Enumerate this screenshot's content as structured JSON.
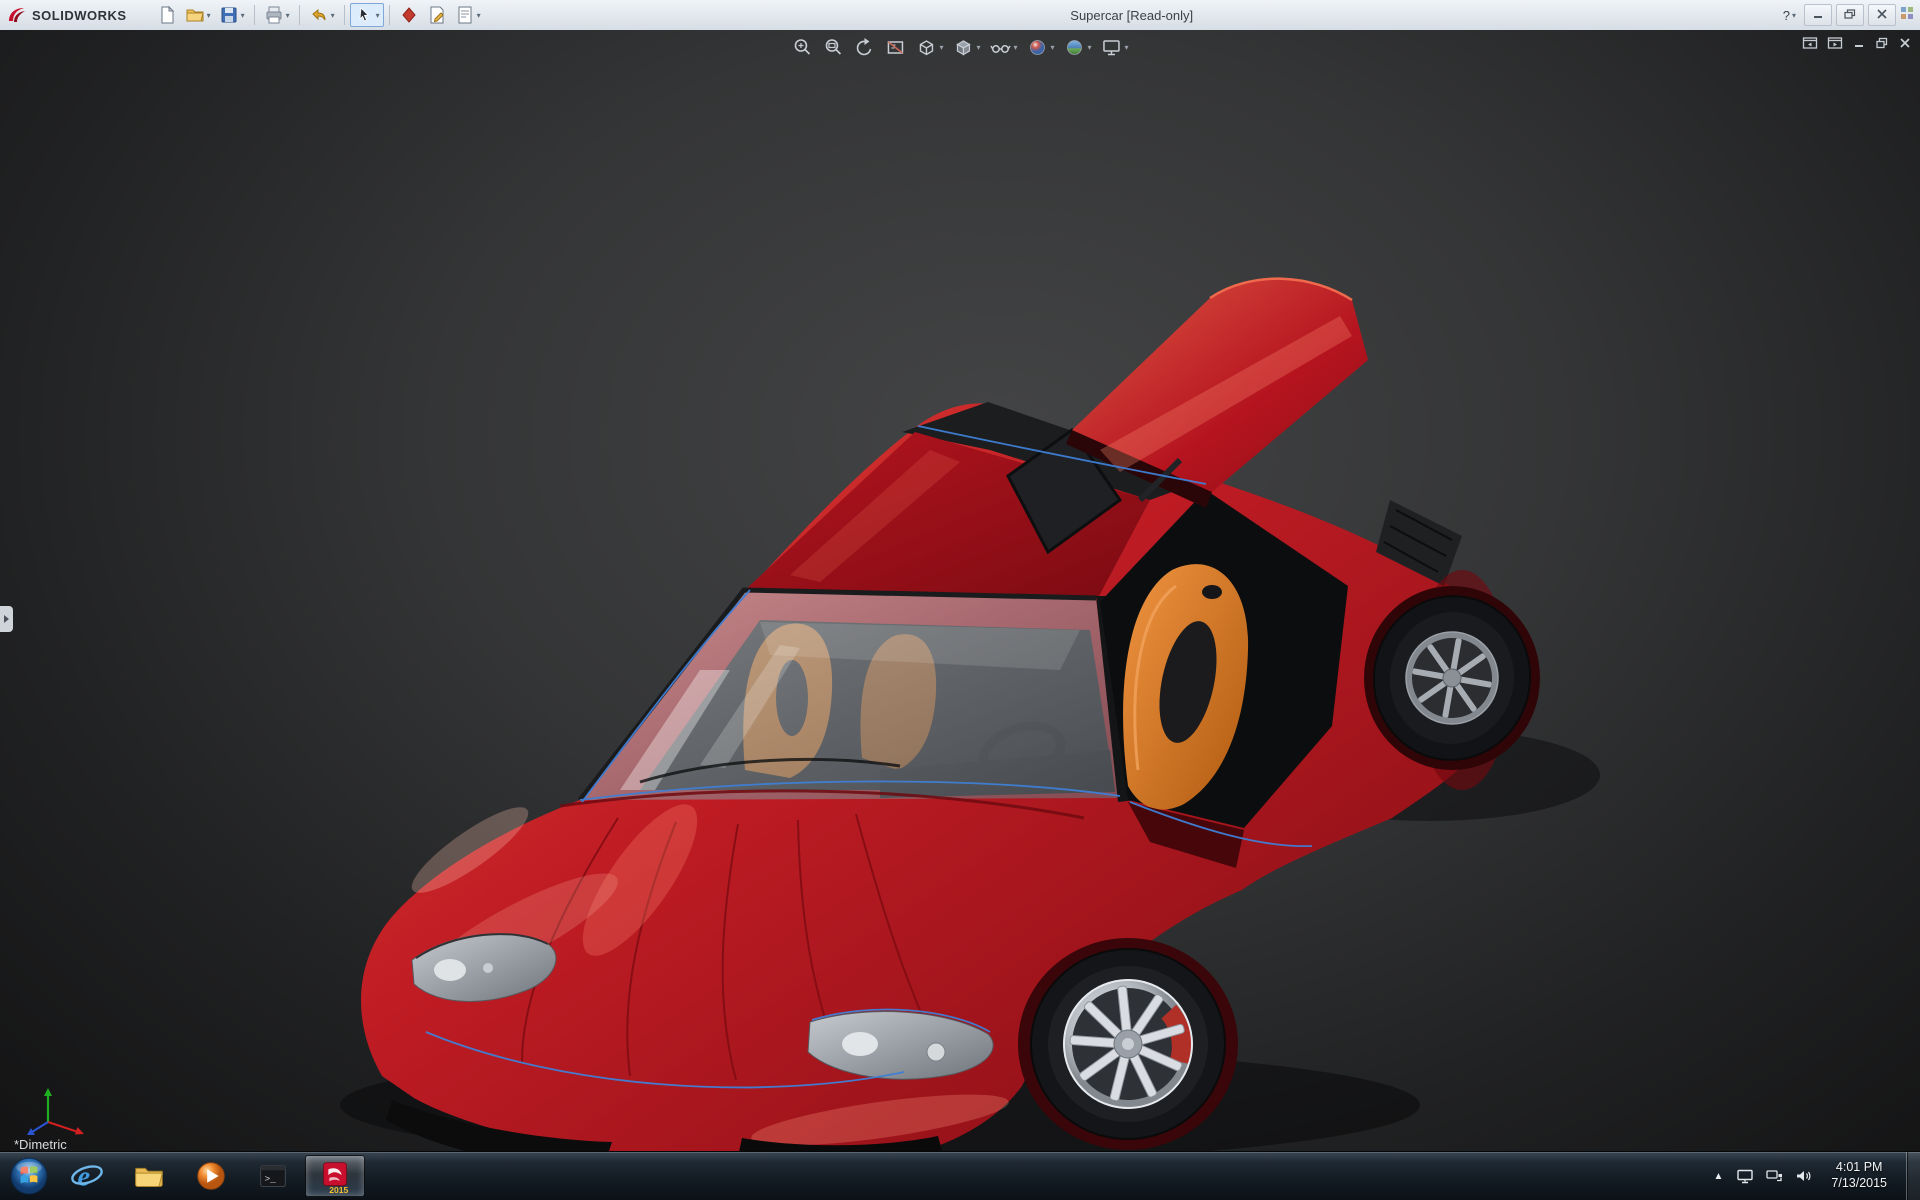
{
  "ui": {
    "dropdown_glyph": "▾"
  },
  "titlebar": {
    "app_name": "SOLIDWORKS",
    "document_title": "Supercar [Read-only]",
    "help_glyph": "?",
    "toolbar_items": [
      {
        "name": "new-document"
      },
      {
        "name": "open",
        "dropdown": true
      },
      {
        "name": "save",
        "dropdown": true
      },
      {
        "name": "print",
        "dropdown": true
      },
      {
        "name": "undo",
        "dropdown": true
      },
      {
        "name": "select",
        "dropdown": true,
        "active": true
      },
      {
        "name": "rebuild"
      },
      {
        "name": "file-properties"
      },
      {
        "name": "options",
        "dropdown": true
      }
    ]
  },
  "heads_up_toolbar": {
    "items": [
      {
        "name": "zoom-to-fit"
      },
      {
        "name": "zoom-to-area"
      },
      {
        "name": "previous-view"
      },
      {
        "name": "section-view"
      },
      {
        "name": "view-orientation",
        "dropdown": true
      },
      {
        "name": "display-style",
        "dropdown": true
      },
      {
        "name": "hide-show-items",
        "dropdown": true
      },
      {
        "name": "edit-appearance",
        "dropdown": true
      },
      {
        "name": "apply-scene",
        "dropdown": true
      },
      {
        "name": "view-settings",
        "dropdown": true
      }
    ]
  },
  "document_window": {
    "controls": [
      "previous-window",
      "next-window",
      "minimize",
      "restore",
      "close"
    ]
  },
  "viewport": {
    "orientation_label": "*Dimetric",
    "model_name": "Supercar",
    "colors": {
      "body": "#b51723",
      "seats": "#e08030",
      "edge_highlight": "#3f7fd6",
      "background_center": "#424344",
      "background_edge": "#121213"
    }
  },
  "taskbar": {
    "ie_glyph": "e",
    "cmd_glyph": ">_",
    "sw_badge": "2015",
    "apps": [
      {
        "name": "start"
      },
      {
        "name": "internet-explorer"
      },
      {
        "name": "windows-explorer"
      },
      {
        "name": "windows-media-player"
      },
      {
        "name": "command-prompt"
      },
      {
        "name": "solidworks-2015",
        "active": true
      }
    ],
    "tray": {
      "hidden_icons_glyph": "▲",
      "time": "4:01 PM",
      "date": "7/13/2015"
    }
  }
}
